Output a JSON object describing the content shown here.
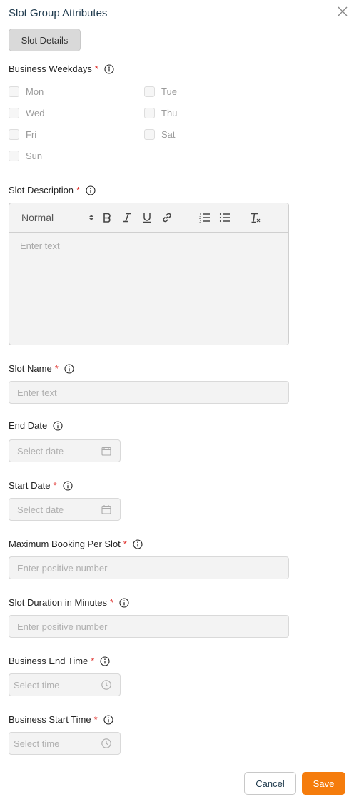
{
  "dialog": {
    "title": "Slot Group Attributes",
    "tab_label": "Slot Details"
  },
  "weekdays": {
    "label": "Business Weekdays",
    "required": "*",
    "days": [
      "Mon",
      "Tue",
      "Wed",
      "Thu",
      "Fri",
      "Sat",
      "Sun"
    ]
  },
  "description": {
    "label": "Slot Description",
    "required": "*",
    "format_select": "Normal",
    "placeholder": "Enter text"
  },
  "slot_name": {
    "label": "Slot Name",
    "required": "*",
    "placeholder": "Enter text"
  },
  "end_date": {
    "label": "End Date",
    "placeholder": "Select date"
  },
  "start_date": {
    "label": "Start Date",
    "required": "*",
    "placeholder": "Select date"
  },
  "max_booking": {
    "label": "Maximum Booking Per Slot",
    "required": "*",
    "placeholder": "Enter positive number"
  },
  "slot_duration": {
    "label": "Slot Duration in Minutes",
    "required": "*",
    "placeholder": "Enter positive number"
  },
  "business_end_time": {
    "label": "Business End Time",
    "required": "*",
    "placeholder": "Select time"
  },
  "business_start_time": {
    "label": "Business Start Time",
    "required": "*",
    "placeholder": "Select time"
  },
  "footer": {
    "cancel_label": "Cancel",
    "save_label": "Save"
  },
  "colors": {
    "accent": "#f57c0c",
    "required": "#e0302b",
    "title": "#1f3a4d"
  },
  "icons": [
    "close-icon",
    "info-icon",
    "bold-icon",
    "italic-icon",
    "underline-icon",
    "link-icon",
    "ordered-list-icon",
    "bullet-list-icon",
    "clear-format-icon",
    "calendar-icon",
    "clock-icon"
  ]
}
